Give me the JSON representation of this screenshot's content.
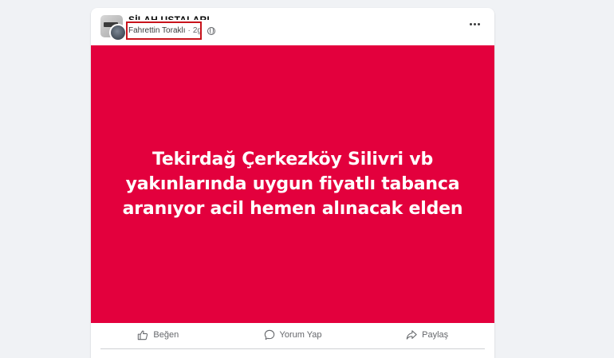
{
  "post": {
    "group_name": "SİLAH USTALARI",
    "author": "Fahrettin Toraklı",
    "separator": "·",
    "time": "2g",
    "banner_text": "Tekirdağ Çerkezköy Silivri vb yakınlarında uygun fiyatlı tabanca aranıyor acil hemen alınacak elden",
    "banner_color": "#e3003d",
    "highlight_color": "#c8131c"
  },
  "actions": {
    "like_label": "Beğen",
    "comment_label": "Yorum Yap",
    "share_label": "Paylaş"
  },
  "icons": {
    "privacy": "globe-icon",
    "more": "more-dots-icon",
    "like": "thumbs-up-icon",
    "comment": "speech-bubble-icon",
    "share": "share-arrow-icon"
  }
}
